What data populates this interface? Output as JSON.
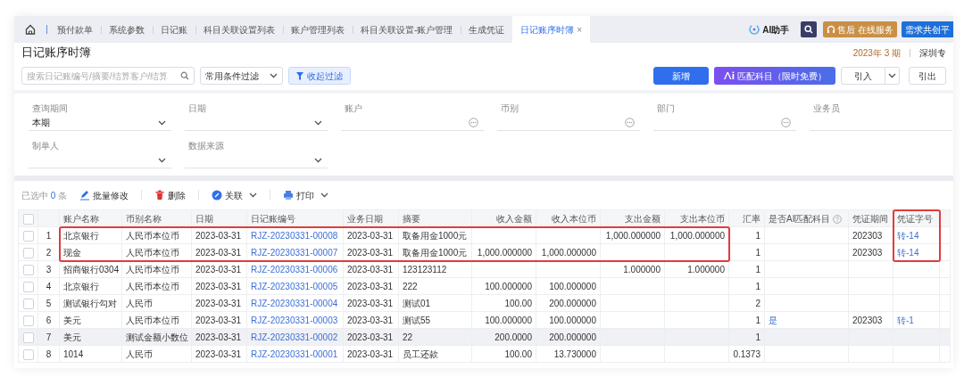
{
  "tabs": [
    {
      "label": "预付款单",
      "selected": false
    },
    {
      "label": "系统参数",
      "selected": false
    },
    {
      "label": "日记账",
      "selected": false
    },
    {
      "label": "科目关联设置列表",
      "selected": false
    },
    {
      "label": "账户管理列表",
      "selected": false
    },
    {
      "label": "科目关联设置-账户管理",
      "selected": false
    },
    {
      "label": "生成凭证",
      "selected": false
    },
    {
      "label": "日记账序时簿",
      "selected": true,
      "close": "×"
    }
  ],
  "header_actions": [
    {
      "kind": "ai",
      "label": "AI助手"
    },
    {
      "kind": "search"
    },
    {
      "kind": "service",
      "label": "售后",
      "sub": "在线服务"
    },
    {
      "kind": "cocreate",
      "label": "需求共创平"
    }
  ],
  "page_title": "日记账序时簿",
  "period": "2023年 3 期",
  "org": "深圳专",
  "search": {
    "placeholder": "搜索日记账编号/摘要/结算客户/结算"
  },
  "condition_select": "常用条件过滤",
  "collapse_button": "收起过滤",
  "buttons": [
    {
      "kind": "primary",
      "label": "新增"
    },
    {
      "kind": "ai",
      "label": "匹配科目（限时免费）"
    },
    {
      "kind": "split",
      "label": "引入"
    },
    {
      "kind": "plain",
      "label": "引出"
    }
  ],
  "filters": [
    {
      "label": "查询期间",
      "kind": "select",
      "value": "本期"
    },
    {
      "label": "日期",
      "kind": "select"
    },
    {
      "label": "账户",
      "kind": "picker"
    },
    {
      "label": "币别",
      "kind": "picker"
    },
    {
      "label": "部门",
      "kind": "picker"
    },
    {
      "label": "业务员",
      "kind": "plain"
    },
    {
      "label": "制单人",
      "kind": "select"
    },
    {
      "label": "数据来源",
      "kind": "select"
    }
  ],
  "selection": {
    "prefix": "已选中",
    "count": "0",
    "suffix": "条"
  },
  "actions": [
    {
      "kind": "edit",
      "label": "批量修改"
    },
    {
      "kind": "delete",
      "label": "删除"
    },
    {
      "kind": "link",
      "label": "关联",
      "menu": true
    },
    {
      "kind": "print",
      "label": "打印",
      "menu": true
    }
  ],
  "table": {
    "header_checked": false,
    "columns": [
      {
        "kind": "index"
      },
      {
        "label": "账户名称",
        "kind": "text"
      },
      {
        "label": "币别名称",
        "kind": "text"
      },
      {
        "label": "日期",
        "kind": "text"
      },
      {
        "label": "日记账编号",
        "kind": "link"
      },
      {
        "label": "业务日期",
        "kind": "text"
      },
      {
        "label": "摘要",
        "kind": "text"
      },
      {
        "label": "收入金额",
        "kind": "number"
      },
      {
        "label": "收入本位币",
        "kind": "number"
      },
      {
        "label": "支出金额",
        "kind": "number"
      },
      {
        "label": "支出本位币",
        "kind": "number"
      },
      {
        "label": "汇率",
        "kind": "number"
      },
      {
        "label": "是否AI匹配科目",
        "kind": "link",
        "help": true
      },
      {
        "label": "凭证期间",
        "kind": "text"
      },
      {
        "label": "凭证字号",
        "kind": "link",
        "boxed": true
      }
    ],
    "rows": [
      {
        "checked": false,
        "boxed": true,
        "hovered": false,
        "cells": [
          "1",
          "北京银行",
          "人民币本位币",
          "2023-03-31",
          "RJZ-20230331-00008",
          "2023-03-31",
          "取备用金1000元",
          null,
          null,
          "1,000.000000",
          "1,000.000000",
          "1",
          null,
          "202303",
          "转-14"
        ]
      },
      {
        "checked": false,
        "boxed": true,
        "hovered": false,
        "cells": [
          "2",
          "现金",
          "人民币本位币",
          "2023-03-31",
          "RJZ-20230331-00007",
          "2023-03-31",
          "取备用金1000元",
          "1,000.000000",
          "1,000.000000",
          null,
          null,
          "1",
          null,
          "202303",
          "转-14"
        ]
      },
      {
        "checked": false,
        "boxed": false,
        "hovered": false,
        "cells": [
          "3",
          "招商银行0304",
          "人民币本位币",
          "2023-03-31",
          "RJZ-20230331-00006",
          "2023-03-31",
          "123123112",
          null,
          null,
          "1.000000",
          "1.000000",
          "1",
          null,
          null,
          null
        ]
      },
      {
        "checked": false,
        "boxed": false,
        "hovered": false,
        "cells": [
          "4",
          "北京银行",
          "人民币本位币",
          "2023-03-31",
          "RJZ-20230331-00005",
          "2023-03-31",
          "222",
          "100.000000",
          "100.000000",
          null,
          null,
          "1",
          null,
          null,
          null
        ]
      },
      {
        "checked": false,
        "boxed": false,
        "hovered": false,
        "cells": [
          "5",
          "测试银行勾对",
          "人民币",
          "2023-03-31",
          "RJZ-20230331-00004",
          "2023-03-31",
          "测试01",
          "100.00",
          "200.000000",
          null,
          null,
          "2",
          null,
          null,
          null
        ]
      },
      {
        "checked": false,
        "boxed": false,
        "hovered": false,
        "cells": [
          "6",
          "美元",
          "人民币本位币",
          "2023-03-31",
          "RJZ-20230331-00003",
          "2023-03-31",
          "测试55",
          "100.000000",
          "100.000000",
          null,
          null,
          "1",
          "是",
          "202303",
          "转-1"
        ]
      },
      {
        "checked": false,
        "boxed": false,
        "hovered": true,
        "cells": [
          "7",
          "美元",
          "测试金额小数位",
          "2023-03-31",
          "RJZ-20230331-00002",
          "2023-03-31",
          "22",
          "200.0000",
          "200.000000",
          null,
          null,
          "1",
          null,
          null,
          null
        ]
      },
      {
        "checked": false,
        "boxed": false,
        "hovered": false,
        "cells": [
          "8",
          "1014",
          "人民币",
          "2023-03-31",
          "RJZ-20230331-00001",
          "2023-03-31",
          "员工还款",
          "100.00",
          "13.730000",
          null,
          null,
          "0.1373",
          null,
          null,
          null
        ]
      }
    ]
  }
}
